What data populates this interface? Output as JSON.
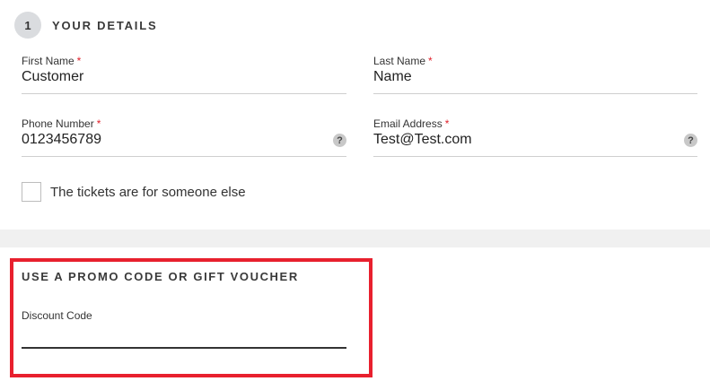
{
  "details": {
    "step_number": "1",
    "title": "YOUR DETAILS",
    "required_marker": "*",
    "fields": {
      "first_name": {
        "label": "First Name",
        "value": "Customer"
      },
      "last_name": {
        "label": "Last Name",
        "value": "Name"
      },
      "phone": {
        "label": "Phone Number",
        "value": "0123456789",
        "help": "?"
      },
      "email": {
        "label": "Email Address",
        "value": "Test@Test.com",
        "help": "?"
      }
    },
    "checkbox_label": "The tickets are for someone else"
  },
  "promo": {
    "title": "USE A PROMO CODE OR GIFT VOUCHER",
    "discount_label": "Discount Code",
    "discount_value": ""
  },
  "colors": {
    "required": "#e0202a",
    "highlight": "#e8202e",
    "band": "#f0f0f0"
  }
}
